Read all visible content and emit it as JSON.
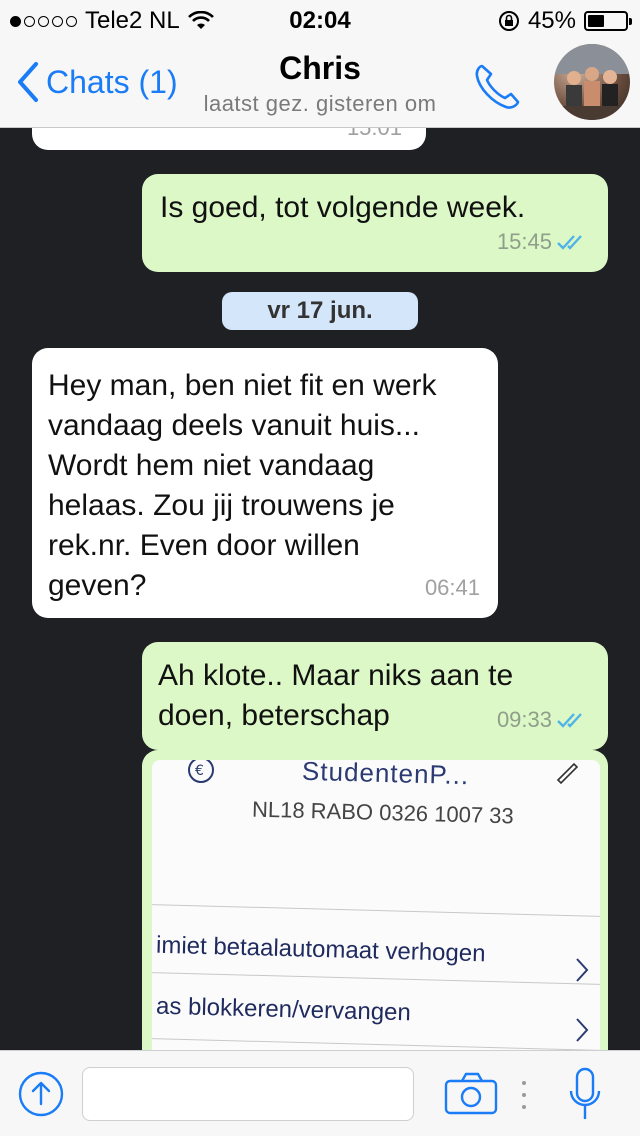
{
  "status": {
    "carrier": "Tele2 NL",
    "time": "02:04",
    "battery": "45%",
    "battery_fraction": 0.45,
    "signal_bars": 1
  },
  "nav": {
    "back_label": "Chats (1)",
    "title": "Chris",
    "subtitle": "laatst gez. gisteren om"
  },
  "messages": [
    {
      "direction": "in",
      "text": "",
      "time": "15:01"
    },
    {
      "direction": "out",
      "text": "Is goed, tot volgende week.",
      "time": "15:45",
      "read": true
    },
    {
      "direction": "in",
      "text": "Hey man, ben niet fit en werk vandaag deels vanuit huis... Wordt hem niet vandaag helaas. Zou jij trouwens je rek.nr. Even door willen geven?",
      "time": "06:41"
    },
    {
      "direction": "out",
      "text": "Ah klote.. Maar niks aan te doen, beterschap",
      "time": "09:33",
      "read": true
    }
  ],
  "date_divider": "vr 17 jun.",
  "image_message": {
    "header_text": "StudentenP...",
    "iban": "NL18 RABO 0326 1007 33",
    "rows": [
      "imiet betaalautomaat verhogen",
      "as blokkeren/vervangen"
    ]
  },
  "input": {
    "placeholder": ""
  },
  "colors": {
    "accent": "#1a7cf6",
    "outgoing": "#dcf8c6",
    "incoming": "#ffffff",
    "background": "#1f2024",
    "tick": "#4fb4e8"
  }
}
